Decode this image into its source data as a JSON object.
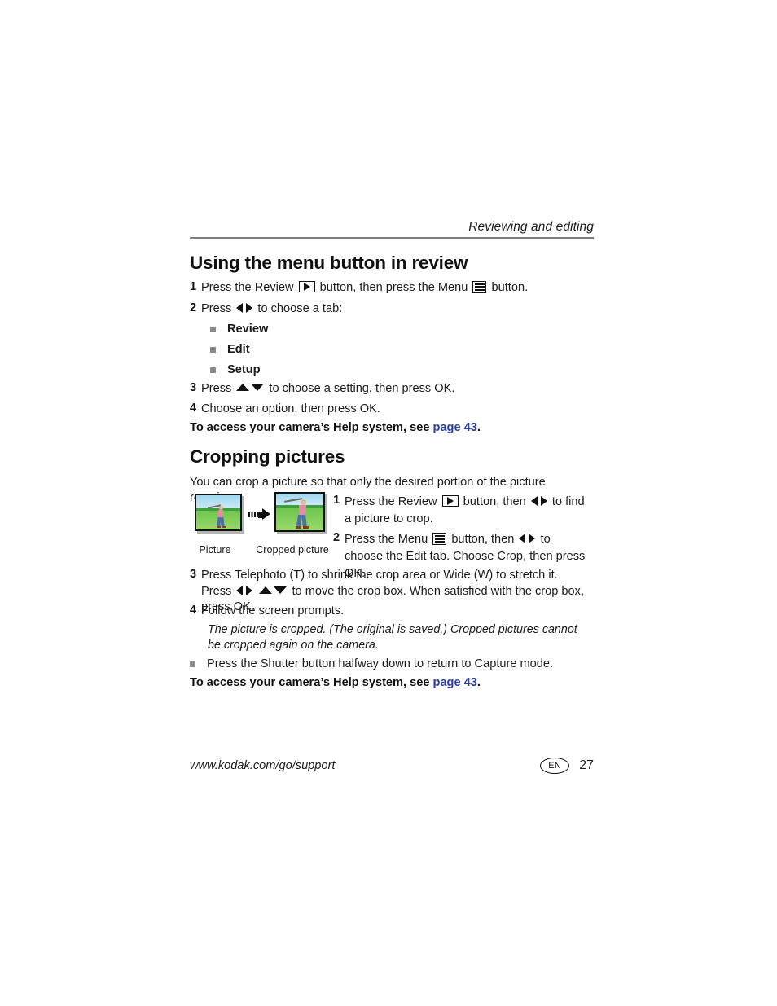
{
  "header": {
    "running_title": "Reviewing and editing"
  },
  "section_menu": {
    "title": "Using the menu button in review",
    "steps": [
      {
        "num": "1",
        "text_before_review_icon": "Press the Review ",
        "text_between": " button, then press the Menu ",
        "text_after": " button."
      },
      {
        "num": "2",
        "text_before": "Press ",
        "text_after": " to choose a tab:"
      },
      {
        "num": "3",
        "text_before": "Press ",
        "text_after": " to choose a setting, then press OK."
      },
      {
        "num": "4",
        "text": "Choose an option, then press OK."
      }
    ],
    "tabs": [
      "Review",
      "Edit",
      "Setup"
    ],
    "help_line_prefix": "To access your camera’s Help system, see ",
    "help_link": "page 43",
    "help_line_suffix": "."
  },
  "section_crop": {
    "title": "Cropping pictures",
    "intro": "You can crop a picture so that only the desired portion of the picture remains.",
    "figure": {
      "caption_left": "Picture",
      "caption_right": "Cropped picture"
    },
    "steps_right": [
      {
        "num": "1",
        "part_a": "Press the Review ",
        "part_b": " button, then ",
        "part_c": " to find a picture to crop."
      },
      {
        "num": "2",
        "part_a": "Press the Menu ",
        "part_b": " button, then ",
        "part_c": " to choose the Edit tab. Choose Crop, then press OK."
      }
    ],
    "step3": {
      "num": "3",
      "part_a": "Press Telephoto (T) to shrink the crop area or Wide (W) to stretch it. Press ",
      "part_b": " ",
      "part_c": " to move the crop box. When satisfied with the crop box, press OK."
    },
    "step4": {
      "num": "4",
      "text": "Follow the screen prompts."
    },
    "note": "The picture is cropped. (The original is saved.) Cropped pictures cannot be cropped again on the camera.",
    "bullet_shutter": "Press the Shutter button halfway down to return to Capture mode.",
    "help_line_prefix": "To access your camera’s Help system, see ",
    "help_link": "page 43",
    "help_line_suffix": "."
  },
  "footer": {
    "url": "www.kodak.com/go/support",
    "language_badge": "EN",
    "page_number": "27"
  },
  "colors": {
    "link": "#2b3ea8",
    "rule": "#7d7d7d",
    "bullet": "#8a8a8a",
    "text": "#1b1b1b"
  },
  "icons": {
    "review_button": "play-triangle-in-box",
    "menu_button": "list-lines-in-box",
    "left_right": "left-right-triangles",
    "up_down": "up-down-triangles",
    "transform_arrow": "dashed-right-arrow"
  }
}
